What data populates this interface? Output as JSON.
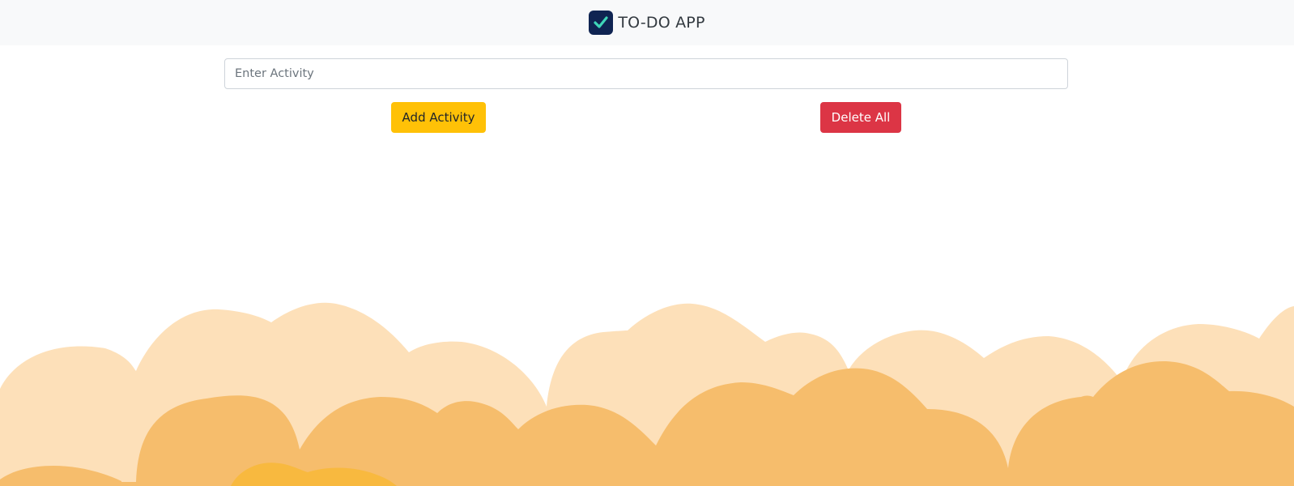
{
  "navbar": {
    "title": "TO-DO APP",
    "logo_icon": "check-icon",
    "logo_bg": "#0f2452",
    "logo_check": "#3fd6b8"
  },
  "form": {
    "input_placeholder": "Enter Activity",
    "input_value": "",
    "add_label": "Add Activity",
    "delete_label": "Delete All"
  },
  "colors": {
    "add_button": "#ffc107",
    "delete_button": "#dc3545",
    "cloud_light": "#fde0b9",
    "cloud_dark": "#f6bd6c",
    "cloud_accent": "#f8b93f"
  }
}
